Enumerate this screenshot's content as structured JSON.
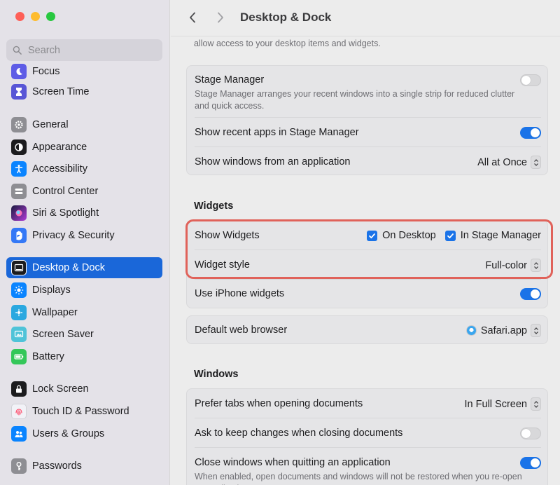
{
  "window": {
    "title": "Desktop & Dock"
  },
  "search": {
    "placeholder": "Search"
  },
  "sidebar": {
    "items": [
      {
        "label": "Focus",
        "icon": "moon-icon",
        "color": "#5e5ce6"
      },
      {
        "label": "Screen Time",
        "icon": "hourglass-icon",
        "color": "#5856d6"
      },
      {
        "label": "General",
        "icon": "gear-icon",
        "color": "#8e8e93"
      },
      {
        "label": "Appearance",
        "icon": "appearance-icon",
        "color": "#1c1c1e"
      },
      {
        "label": "Accessibility",
        "icon": "accessibility-icon",
        "color": "#0a84ff"
      },
      {
        "label": "Control Center",
        "icon": "control-center-icon",
        "color": "#8e8e93"
      },
      {
        "label": "Siri & Spotlight",
        "icon": "siri-icon",
        "color": "#b03ad6"
      },
      {
        "label": "Privacy & Security",
        "icon": "hand-icon",
        "color": "#3478f6"
      },
      {
        "label": "Desktop & Dock",
        "icon": "dock-icon",
        "color": "#1c1c1e",
        "selected": true
      },
      {
        "label": "Displays",
        "icon": "sun-icon",
        "color": "#0a84ff"
      },
      {
        "label": "Wallpaper",
        "icon": "wallpaper-icon",
        "color": "#2aa8e0"
      },
      {
        "label": "Screen Saver",
        "icon": "screen-saver-icon",
        "color": "#4fc3d8"
      },
      {
        "label": "Battery",
        "icon": "battery-icon",
        "color": "#34c759"
      },
      {
        "label": "Lock Screen",
        "icon": "lock-icon",
        "color": "#1c1c1e"
      },
      {
        "label": "Touch ID & Password",
        "icon": "fingerprint-icon",
        "color": "#f2f2f7"
      },
      {
        "label": "Users & Groups",
        "icon": "users-icon",
        "color": "#0a84ff"
      },
      {
        "label": "Passwords",
        "icon": "key-icon",
        "color": "#8e8e93"
      }
    ]
  },
  "main": {
    "intro": "allow access to your desktop items and widgets.",
    "stage_manager": {
      "label": "Stage Manager",
      "description": "Stage Manager arranges your recent windows into a single strip for reduced clutter and quick access.",
      "enabled": false,
      "recent_apps_label": "Show recent apps in Stage Manager",
      "recent_apps_enabled": true,
      "windows_label": "Show windows from an application",
      "windows_value": "All at Once"
    },
    "widgets": {
      "section_title": "Widgets",
      "show_label": "Show Widgets",
      "on_desktop_label": "On Desktop",
      "on_desktop_checked": true,
      "in_stage_label": "In Stage Manager",
      "in_stage_checked": true,
      "style_label": "Widget style",
      "style_value": "Full-color",
      "iphone_label": "Use iPhone widgets",
      "iphone_enabled": true
    },
    "browser": {
      "label": "Default web browser",
      "value": "Safari.app"
    },
    "windows": {
      "section_title": "Windows",
      "prefer_tabs_label": "Prefer tabs when opening documents",
      "prefer_tabs_value": "In Full Screen",
      "ask_keep_label": "Ask to keep changes when closing documents",
      "ask_keep_enabled": false,
      "close_windows_label": "Close windows when quitting an application",
      "close_windows_enabled": true,
      "close_windows_desc": "When enabled, open documents and windows will not be restored when you re-open an application."
    }
  },
  "colors": {
    "accent": "#1a73e8",
    "highlight": "#e0625a",
    "selected": "#1a67d9"
  }
}
